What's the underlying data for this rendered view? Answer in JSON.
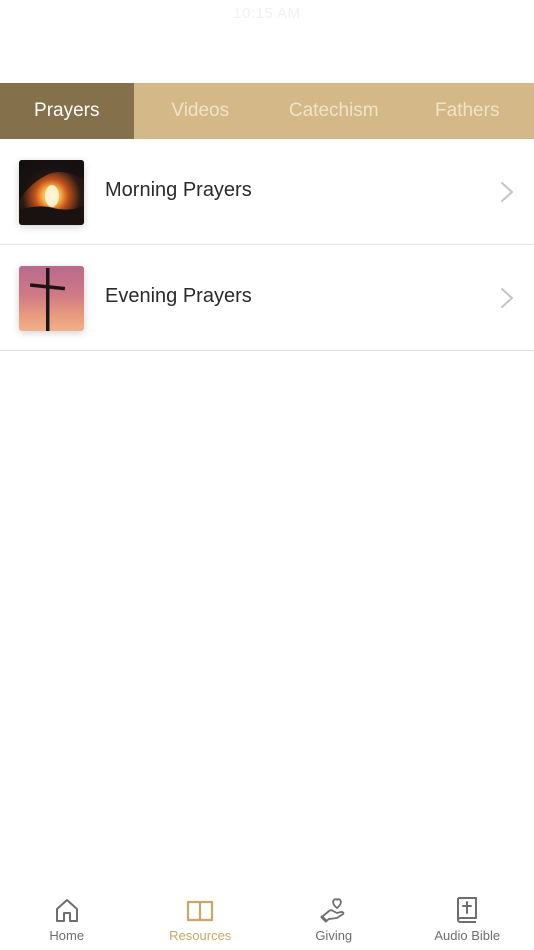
{
  "status_bar": {
    "time": "10:15 AM"
  },
  "tabs": [
    {
      "label": "Prayers",
      "active": true
    },
    {
      "label": "Videos",
      "active": false
    },
    {
      "label": "Catechism",
      "active": false
    },
    {
      "label": "Fathers",
      "active": false
    }
  ],
  "items": [
    {
      "title": "Morning Prayers",
      "thumbnail": "fire-cave-image"
    },
    {
      "title": "Evening Prayers",
      "thumbnail": "cross-sunset-image"
    }
  ],
  "bottom_nav": [
    {
      "label": "Home",
      "icon": "home-icon",
      "active": false
    },
    {
      "label": "Resources",
      "icon": "book-icon",
      "active": true
    },
    {
      "label": "Giving",
      "icon": "hand-heart-icon",
      "active": false
    },
    {
      "label": "Audio Bible",
      "icon": "bible-icon",
      "active": false
    }
  ],
  "colors": {
    "tab_bar": "#d4b887",
    "tab_active": "#84704a",
    "accent": "#c9a766",
    "nav_inactive": "#6e6e6e"
  }
}
